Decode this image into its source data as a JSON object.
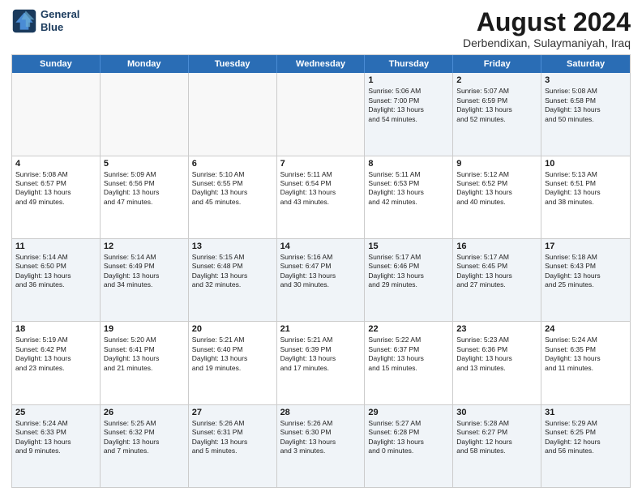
{
  "header": {
    "logo_line1": "General",
    "logo_line2": "Blue",
    "month": "August 2024",
    "location": "Derbendixan, Sulaymaniyah, Iraq"
  },
  "weekdays": [
    "Sunday",
    "Monday",
    "Tuesday",
    "Wednesday",
    "Thursday",
    "Friday",
    "Saturday"
  ],
  "rows": [
    [
      {
        "day": "",
        "lines": []
      },
      {
        "day": "",
        "lines": []
      },
      {
        "day": "",
        "lines": []
      },
      {
        "day": "",
        "lines": []
      },
      {
        "day": "1",
        "lines": [
          "Sunrise: 5:06 AM",
          "Sunset: 7:00 PM",
          "Daylight: 13 hours",
          "and 54 minutes."
        ]
      },
      {
        "day": "2",
        "lines": [
          "Sunrise: 5:07 AM",
          "Sunset: 6:59 PM",
          "Daylight: 13 hours",
          "and 52 minutes."
        ]
      },
      {
        "day": "3",
        "lines": [
          "Sunrise: 5:08 AM",
          "Sunset: 6:58 PM",
          "Daylight: 13 hours",
          "and 50 minutes."
        ]
      }
    ],
    [
      {
        "day": "4",
        "lines": [
          "Sunrise: 5:08 AM",
          "Sunset: 6:57 PM",
          "Daylight: 13 hours",
          "and 49 minutes."
        ]
      },
      {
        "day": "5",
        "lines": [
          "Sunrise: 5:09 AM",
          "Sunset: 6:56 PM",
          "Daylight: 13 hours",
          "and 47 minutes."
        ]
      },
      {
        "day": "6",
        "lines": [
          "Sunrise: 5:10 AM",
          "Sunset: 6:55 PM",
          "Daylight: 13 hours",
          "and 45 minutes."
        ]
      },
      {
        "day": "7",
        "lines": [
          "Sunrise: 5:11 AM",
          "Sunset: 6:54 PM",
          "Daylight: 13 hours",
          "and 43 minutes."
        ]
      },
      {
        "day": "8",
        "lines": [
          "Sunrise: 5:11 AM",
          "Sunset: 6:53 PM",
          "Daylight: 13 hours",
          "and 42 minutes."
        ]
      },
      {
        "day": "9",
        "lines": [
          "Sunrise: 5:12 AM",
          "Sunset: 6:52 PM",
          "Daylight: 13 hours",
          "and 40 minutes."
        ]
      },
      {
        "day": "10",
        "lines": [
          "Sunrise: 5:13 AM",
          "Sunset: 6:51 PM",
          "Daylight: 13 hours",
          "and 38 minutes."
        ]
      }
    ],
    [
      {
        "day": "11",
        "lines": [
          "Sunrise: 5:14 AM",
          "Sunset: 6:50 PM",
          "Daylight: 13 hours",
          "and 36 minutes."
        ]
      },
      {
        "day": "12",
        "lines": [
          "Sunrise: 5:14 AM",
          "Sunset: 6:49 PM",
          "Daylight: 13 hours",
          "and 34 minutes."
        ]
      },
      {
        "day": "13",
        "lines": [
          "Sunrise: 5:15 AM",
          "Sunset: 6:48 PM",
          "Daylight: 13 hours",
          "and 32 minutes."
        ]
      },
      {
        "day": "14",
        "lines": [
          "Sunrise: 5:16 AM",
          "Sunset: 6:47 PM",
          "Daylight: 13 hours",
          "and 30 minutes."
        ]
      },
      {
        "day": "15",
        "lines": [
          "Sunrise: 5:17 AM",
          "Sunset: 6:46 PM",
          "Daylight: 13 hours",
          "and 29 minutes."
        ]
      },
      {
        "day": "16",
        "lines": [
          "Sunrise: 5:17 AM",
          "Sunset: 6:45 PM",
          "Daylight: 13 hours",
          "and 27 minutes."
        ]
      },
      {
        "day": "17",
        "lines": [
          "Sunrise: 5:18 AM",
          "Sunset: 6:43 PM",
          "Daylight: 13 hours",
          "and 25 minutes."
        ]
      }
    ],
    [
      {
        "day": "18",
        "lines": [
          "Sunrise: 5:19 AM",
          "Sunset: 6:42 PM",
          "Daylight: 13 hours",
          "and 23 minutes."
        ]
      },
      {
        "day": "19",
        "lines": [
          "Sunrise: 5:20 AM",
          "Sunset: 6:41 PM",
          "Daylight: 13 hours",
          "and 21 minutes."
        ]
      },
      {
        "day": "20",
        "lines": [
          "Sunrise: 5:21 AM",
          "Sunset: 6:40 PM",
          "Daylight: 13 hours",
          "and 19 minutes."
        ]
      },
      {
        "day": "21",
        "lines": [
          "Sunrise: 5:21 AM",
          "Sunset: 6:39 PM",
          "Daylight: 13 hours",
          "and 17 minutes."
        ]
      },
      {
        "day": "22",
        "lines": [
          "Sunrise: 5:22 AM",
          "Sunset: 6:37 PM",
          "Daylight: 13 hours",
          "and 15 minutes."
        ]
      },
      {
        "day": "23",
        "lines": [
          "Sunrise: 5:23 AM",
          "Sunset: 6:36 PM",
          "Daylight: 13 hours",
          "and 13 minutes."
        ]
      },
      {
        "day": "24",
        "lines": [
          "Sunrise: 5:24 AM",
          "Sunset: 6:35 PM",
          "Daylight: 13 hours",
          "and 11 minutes."
        ]
      }
    ],
    [
      {
        "day": "25",
        "lines": [
          "Sunrise: 5:24 AM",
          "Sunset: 6:33 PM",
          "Daylight: 13 hours",
          "and 9 minutes."
        ]
      },
      {
        "day": "26",
        "lines": [
          "Sunrise: 5:25 AM",
          "Sunset: 6:32 PM",
          "Daylight: 13 hours",
          "and 7 minutes."
        ]
      },
      {
        "day": "27",
        "lines": [
          "Sunrise: 5:26 AM",
          "Sunset: 6:31 PM",
          "Daylight: 13 hours",
          "and 5 minutes."
        ]
      },
      {
        "day": "28",
        "lines": [
          "Sunrise: 5:26 AM",
          "Sunset: 6:30 PM",
          "Daylight: 13 hours",
          "and 3 minutes."
        ]
      },
      {
        "day": "29",
        "lines": [
          "Sunrise: 5:27 AM",
          "Sunset: 6:28 PM",
          "Daylight: 13 hours",
          "and 0 minutes."
        ]
      },
      {
        "day": "30",
        "lines": [
          "Sunrise: 5:28 AM",
          "Sunset: 6:27 PM",
          "Daylight: 12 hours",
          "and 58 minutes."
        ]
      },
      {
        "day": "31",
        "lines": [
          "Sunrise: 5:29 AM",
          "Sunset: 6:25 PM",
          "Daylight: 12 hours",
          "and 56 minutes."
        ]
      }
    ]
  ]
}
